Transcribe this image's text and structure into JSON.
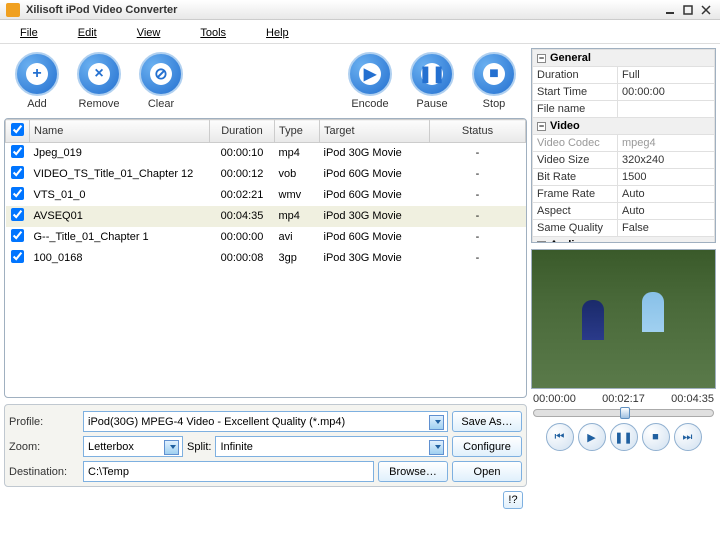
{
  "window": {
    "title": "Xilisoft iPod Video Converter"
  },
  "menu": [
    "File",
    "Edit",
    "View",
    "Tools",
    "Help"
  ],
  "tools": {
    "add": "Add",
    "remove": "Remove",
    "clear": "Clear",
    "encode": "Encode",
    "pause": "Pause",
    "stop": "Stop"
  },
  "grid": {
    "cols": {
      "check": "",
      "name": "Name",
      "duration": "Duration",
      "type": "Type",
      "target": "Target",
      "status": "Status"
    },
    "rows": [
      {
        "checked": true,
        "name": "Jpeg_019",
        "duration": "00:00:10",
        "type": "mp4",
        "target": "iPod 30G Movie",
        "status": "-",
        "sel": false
      },
      {
        "checked": true,
        "name": "VIDEO_TS_Title_01_Chapter 12",
        "duration": "00:00:12",
        "type": "vob",
        "target": "iPod 60G Movie",
        "status": "-",
        "sel": false
      },
      {
        "checked": true,
        "name": "VTS_01_0",
        "duration": "00:02:21",
        "type": "wmv",
        "target": "iPod 60G Movie",
        "status": "-",
        "sel": false
      },
      {
        "checked": true,
        "name": "AVSEQ01",
        "duration": "00:04:35",
        "type": "mp4",
        "target": "iPod 30G Movie",
        "status": "-",
        "sel": true
      },
      {
        "checked": true,
        "name": "G--_Title_01_Chapter 1",
        "duration": "00:00:00",
        "type": "avi",
        "target": "iPod 60G Movie",
        "status": "-",
        "sel": false
      },
      {
        "checked": true,
        "name": "100_0168",
        "duration": "00:00:08",
        "type": "3gp",
        "target": "iPod 30G Movie",
        "status": "-",
        "sel": false
      }
    ]
  },
  "form": {
    "profile_label": "Profile:",
    "profile": "iPod(30G) MPEG-4 Video - Excellent Quality  (*.mp4)",
    "save_as": "Save As…",
    "zoom_label": "Zoom:",
    "zoom": "Letterbox",
    "split_label": "Split:",
    "split": "Infinite",
    "configure": "Configure",
    "dest_label": "Destination:",
    "dest": "C:\\Temp",
    "browse": "Browse…",
    "open": "Open"
  },
  "props": {
    "general": "General",
    "duration_k": "Duration",
    "duration_v": "Full",
    "start_k": "Start Time",
    "start_v": "00:00:00",
    "file_k": "File name",
    "file_v": "",
    "video": "Video",
    "codec_k": "Video Codec",
    "codec_v": "mpeg4",
    "size_k": "Video Size",
    "size_v": "320x240",
    "bitrate_k": "Bit Rate",
    "bitrate_v": "1500",
    "frame_k": "Frame Rate",
    "frame_v": "Auto",
    "aspect_k": "Aspect",
    "aspect_v": "Auto",
    "same_k": "Same Quality",
    "same_v": "False",
    "audio": "Audio"
  },
  "player": {
    "t1": "00:00:00",
    "t2": "00:02:17",
    "t3": "00:04:35"
  },
  "help": "!?"
}
